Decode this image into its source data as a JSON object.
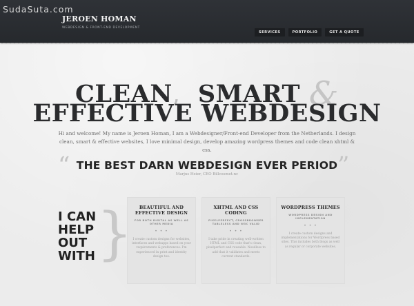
{
  "watermark": "SudaSuta.com",
  "header": {
    "name": "JEROEN HOMAN",
    "tagline": "WEBDESIGN & FRONT-END DEVELOPMENT",
    "nav": [
      "SERVICES",
      "PORTFOLIO",
      "GET A QUOTE"
    ]
  },
  "hero": {
    "word1": "CLEAN",
    "comma": ",",
    "word2": "SMART",
    "amp": "&",
    "line2": "EFFECTIVE WEBDESIGN",
    "intro": "Hi and welcome! My name is Jeroen Homan, I am a Webdesigner/Front-end Developer from the Netherlands. I design clean, smart & effective websites, I love minimal design, develop amazing wordpress themes and code clean xhtml & css."
  },
  "quote": {
    "open": "“",
    "close": "”",
    "text": "THE BEST DARN WEBDESIGN EVER PERIOD",
    "author": "Marjus Heier, CEO Billcosmet.nc"
  },
  "help": {
    "heading": [
      "I CAN",
      "HELP",
      "OUT",
      "WITH"
    ],
    "brace": "}",
    "cards": [
      {
        "title": "BEAUTIFUL AND EFFECTIVE DESIGN",
        "sub": "FOR BOTH DIGITAL AS WELL AS OTHER MEDIA",
        "dots": "• • •",
        "body": "I create custom designs for websites, interfaces and webapps based on your requirements & preferences. I'm experienced in print and identity design too."
      },
      {
        "title": "XHTML AND CSS CODING",
        "sub": "PIXELPERFECT, CROSSBROWSER TABLELESS AND W3C VALID",
        "dots": "• • •",
        "body": "I take pride in creating well-written HTML and CSS code that's clean, pixelperfect and reusable. Needless to add that it validates and meets current standards."
      },
      {
        "title": "WORDPRESS THEMES",
        "sub": "WORDPRESS DESIGN AND IMPLEMENTATION",
        "dots": "• • •",
        "body": "I create custom designs and implementations for Wordpress based sites. This includes both blogs as well as regular or corporate websites."
      }
    ]
  }
}
